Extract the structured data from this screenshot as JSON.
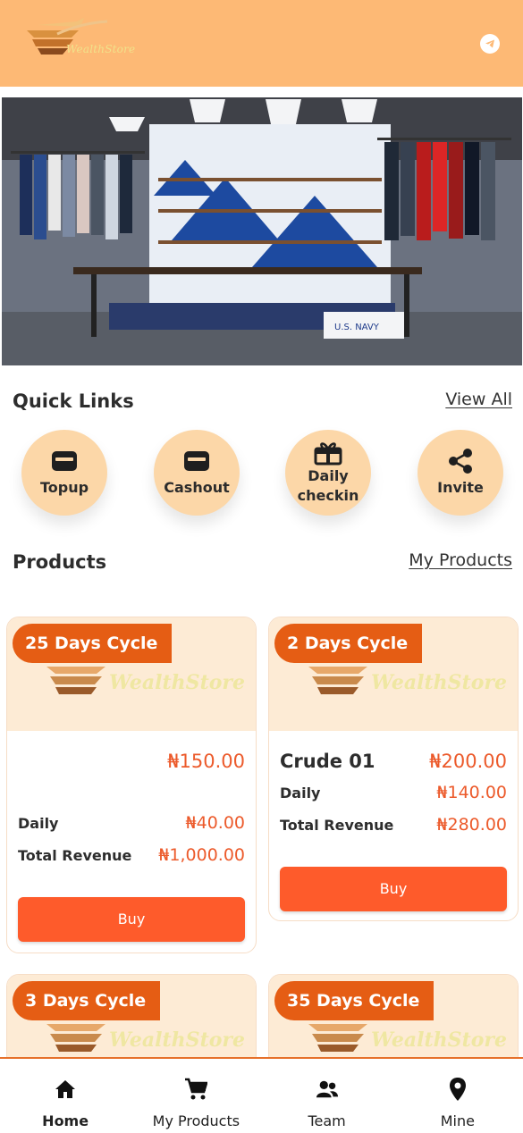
{
  "header": {
    "brand": "WealthStore",
    "telegram_icon": "telegram-icon",
    "background": "#fdb975"
  },
  "banner": {
    "signs": [
      "U.S. NAVY"
    ]
  },
  "quick_links": {
    "title": "Quick Links",
    "view_all": "View All",
    "items": [
      {
        "label": "Topup",
        "icon": "wallet-icon"
      },
      {
        "label": "Cashout",
        "icon": "wallet-icon"
      },
      {
        "label": "Daily checkin",
        "line1": "Daily",
        "line2": "checkin",
        "icon": "gift-icon"
      },
      {
        "label": "Invite",
        "icon": "share-icon"
      }
    ]
  },
  "products": {
    "title": "Products",
    "my_products_link": "My Products",
    "watermark": "WealthStore",
    "cards": [
      {
        "cycle": "25 Days Cycle",
        "name": "",
        "price": "₦150.00",
        "daily_label": "Daily",
        "daily": "₦40.00",
        "revenue_label": "Total Revenue",
        "revenue": "₦1,000.00",
        "buy": "Buy"
      },
      {
        "cycle": "2 Days Cycle",
        "name": "Crude 01",
        "price": "₦200.00",
        "daily_label": "Daily",
        "daily": "₦140.00",
        "revenue_label": "Total Revenue",
        "revenue": "₦280.00",
        "buy": "Buy"
      },
      {
        "cycle": "3 Days Cycle"
      },
      {
        "cycle": "35 Days Cycle"
      }
    ]
  },
  "bottom_nav": {
    "items": [
      {
        "label": "Home",
        "icon": "home-icon",
        "active": true
      },
      {
        "label": "My Products",
        "icon": "cart-icon"
      },
      {
        "label": "Team",
        "icon": "team-icon"
      },
      {
        "label": "Mine",
        "icon": "location-pin-icon"
      }
    ]
  },
  "colors": {
    "accent": "#fe5b2b",
    "cycle_badge": "#e55d14",
    "price": "#ec5a2b",
    "quick_link_bg": "#fcd7a8",
    "card_top_bg": "#fdebd5"
  }
}
